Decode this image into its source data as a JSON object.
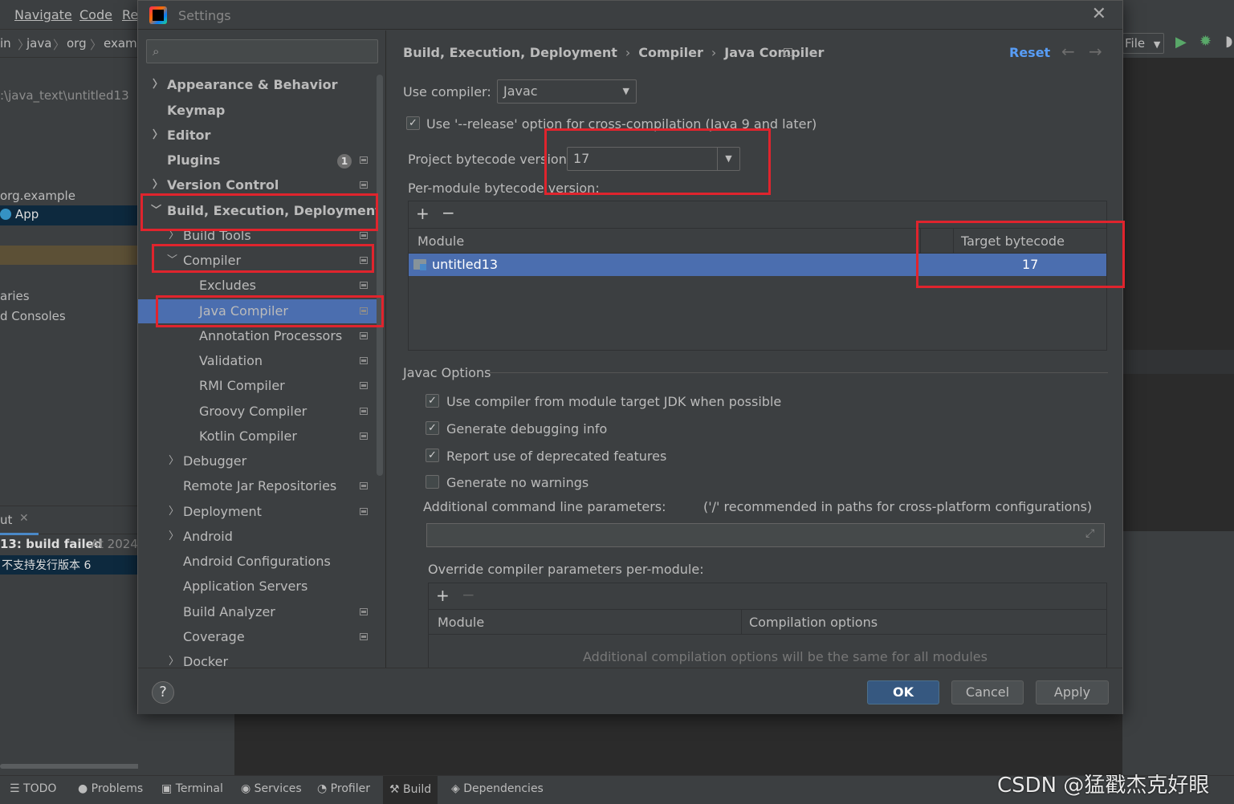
{
  "ide": {
    "menu": [
      "Navigate",
      "Code",
      "Re"
    ],
    "navbar": [
      "in",
      "java",
      "org",
      "examp"
    ],
    "left_panel": {
      "path": ":\\java_text\\untitled13",
      "package": "org.example",
      "class": "App",
      "libraries": "aries",
      "consoles": "d Consoles",
      "output_tab": "ut",
      "build_status": "13: build failed",
      "build_time": "At 2024",
      "error_msg": "不支持发行版本 6"
    },
    "right_toolbar": {
      "config": "File"
    },
    "tool_windows": [
      "TODO",
      "Problems",
      "Terminal",
      "Services",
      "Profiler",
      "Build",
      "Dependencies"
    ],
    "watermark": "CSDN @猛戳杰克好眼"
  },
  "dialog": {
    "title": "Settings",
    "search_placeholder": "",
    "tree": [
      {
        "label": "Appearance & Behavior"
      },
      {
        "label": "Keymap"
      },
      {
        "label": "Editor"
      },
      {
        "label": "Plugins",
        "badge": "1"
      },
      {
        "label": "Version Control"
      },
      {
        "label": "Build, Execution, Deployment"
      },
      {
        "label": "Build Tools"
      },
      {
        "label": "Compiler"
      },
      {
        "label": "Excludes"
      },
      {
        "label": "Java Compiler"
      },
      {
        "label": "Annotation Processors"
      },
      {
        "label": "Validation"
      },
      {
        "label": "RMI Compiler"
      },
      {
        "label": "Groovy Compiler"
      },
      {
        "label": "Kotlin Compiler"
      },
      {
        "label": "Debugger"
      },
      {
        "label": "Remote Jar Repositories"
      },
      {
        "label": "Deployment"
      },
      {
        "label": "Android"
      },
      {
        "label": "Android Configurations"
      },
      {
        "label": "Application Servers"
      },
      {
        "label": "Build Analyzer"
      },
      {
        "label": "Coverage"
      },
      {
        "label": "Docker"
      }
    ],
    "breadcrumb": [
      "Build, Execution, Deployment",
      "Compiler",
      "Java Compiler"
    ],
    "reset_label": "Reset",
    "use_compiler_label": "Use compiler:",
    "use_compiler_value": "Javac",
    "release_option_label": "Use '--release' option for cross-compilation (Java 9 and later)",
    "release_option_checked": true,
    "project_bytecode_label": "Project bytecode version:",
    "project_bytecode_value": "17",
    "per_module_label": "Per-module bytecode version:",
    "module_table": {
      "headers": [
        "Module",
        "Target bytecode version"
      ],
      "rows": [
        {
          "module": "untitled13",
          "version": "17"
        }
      ]
    },
    "javac_options_title": "Javac Options",
    "javac_options": [
      {
        "label": "Use compiler from module target JDK when possible",
        "checked": true
      },
      {
        "label": "Generate debugging info",
        "checked": true
      },
      {
        "label": "Report use of deprecated features",
        "checked": true
      },
      {
        "label": "Generate no warnings",
        "checked": false
      }
    ],
    "additional_params_label": "Additional command line parameters:",
    "additional_params_hint": "('/' recommended in paths for cross-platform configurations)",
    "additional_params_value": "",
    "override_label": "Override compiler parameters per-module:",
    "override_table": {
      "headers": [
        "Module",
        "Compilation options"
      ],
      "empty_text": "Additional compilation options will be the same for all modules"
    },
    "buttons": {
      "ok": "OK",
      "cancel": "Cancel",
      "apply": "Apply",
      "help": "?"
    }
  },
  "colors": {
    "selection": "#4b6eaf",
    "link": "#589df6",
    "highlight_box": "#e0242d",
    "background": "#3c3f41"
  }
}
